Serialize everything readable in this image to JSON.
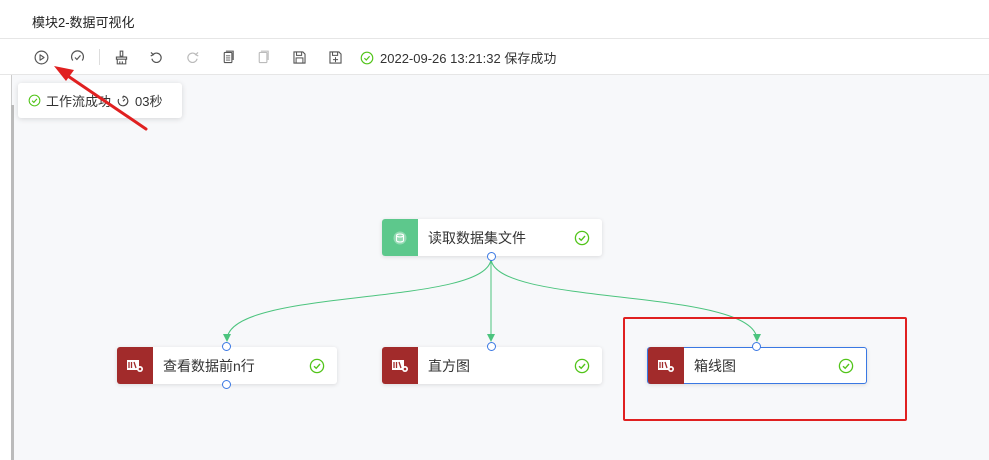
{
  "window": {
    "title": "模块2-数据可视化"
  },
  "toolbar": {
    "buttons": [
      {
        "name": "run-icon"
      },
      {
        "name": "run-check-icon"
      },
      {
        "name": "clear-icon"
      },
      {
        "name": "undo-icon"
      },
      {
        "name": "redo-icon"
      },
      {
        "name": "copy-icon"
      },
      {
        "name": "paste-icon"
      },
      {
        "name": "save-icon"
      },
      {
        "name": "save-as-icon"
      }
    ],
    "save_status": "2022-09-26 13:21:32 保存成功"
  },
  "run_popup": {
    "status": "工作流成功",
    "duration": "03秒"
  },
  "nodes": [
    {
      "label": "读取数据集文件",
      "kind": "dataset",
      "state": "success"
    },
    {
      "label": "查看数据前n行",
      "kind": "script",
      "state": "success"
    },
    {
      "label": "直方图",
      "kind": "script",
      "state": "success"
    },
    {
      "label": "箱线图",
      "kind": "script",
      "state": "success",
      "selected": true
    }
  ],
  "colors": {
    "success": "#52c41a",
    "edge": "#4cc47e",
    "port": "#3a78e3",
    "dataset_badge": "#5dc88c",
    "script_badge": "#a22b2b",
    "annotation": "#e02020"
  }
}
